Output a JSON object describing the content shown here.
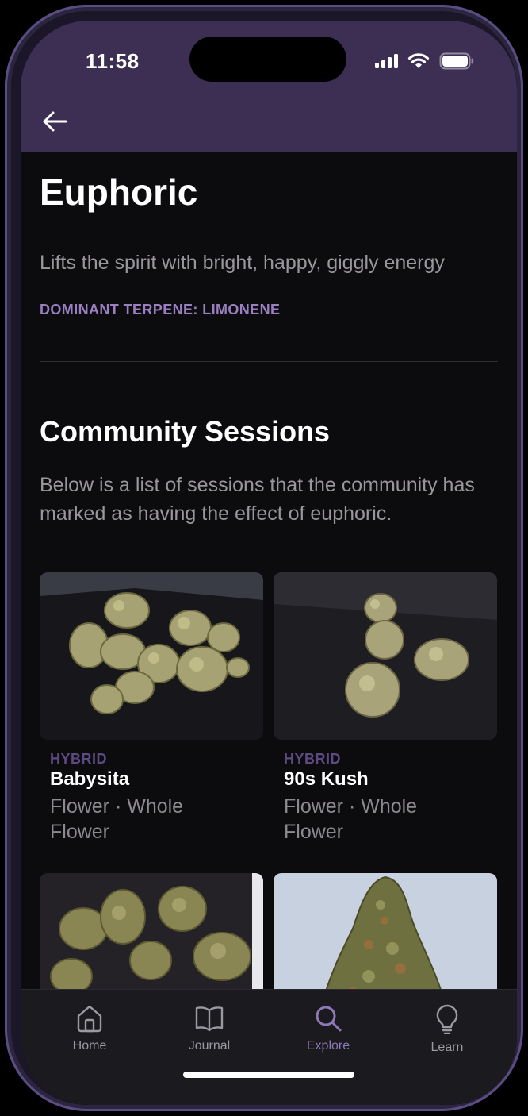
{
  "status_bar": {
    "time": "11:58"
  },
  "header": {
    "back_icon": "arrow-left-icon"
  },
  "effect": {
    "title": "Euphoric",
    "description": "Lifts the spirit with bright, happy, giggly energy",
    "terpene": "DOMINANT TERPENE: LIMONENE"
  },
  "community": {
    "title": "Community Sessions",
    "description": "Below is a list of sessions that the community has marked as having the effect of euphoric."
  },
  "sessions": [
    {
      "type": "HYBRID",
      "name": "Babysita",
      "form": "Flower · Whole Flower"
    },
    {
      "type": "HYBRID",
      "name": "90s Kush",
      "form": "Flower · Whole Flower"
    },
    {
      "type": "",
      "name": "",
      "form": ""
    },
    {
      "type": "",
      "name": "",
      "form": ""
    }
  ],
  "tabbar": {
    "tabs": [
      {
        "label": "Home",
        "icon": "home-icon"
      },
      {
        "label": "Journal",
        "icon": "book-icon"
      },
      {
        "label": "Explore",
        "icon": "search-icon",
        "active": true
      },
      {
        "label": "Learn",
        "icon": "lightbulb-icon"
      }
    ]
  },
  "colors": {
    "accent": "#8e78b7",
    "header": "#3d2e54",
    "background": "#0c0b0e"
  }
}
